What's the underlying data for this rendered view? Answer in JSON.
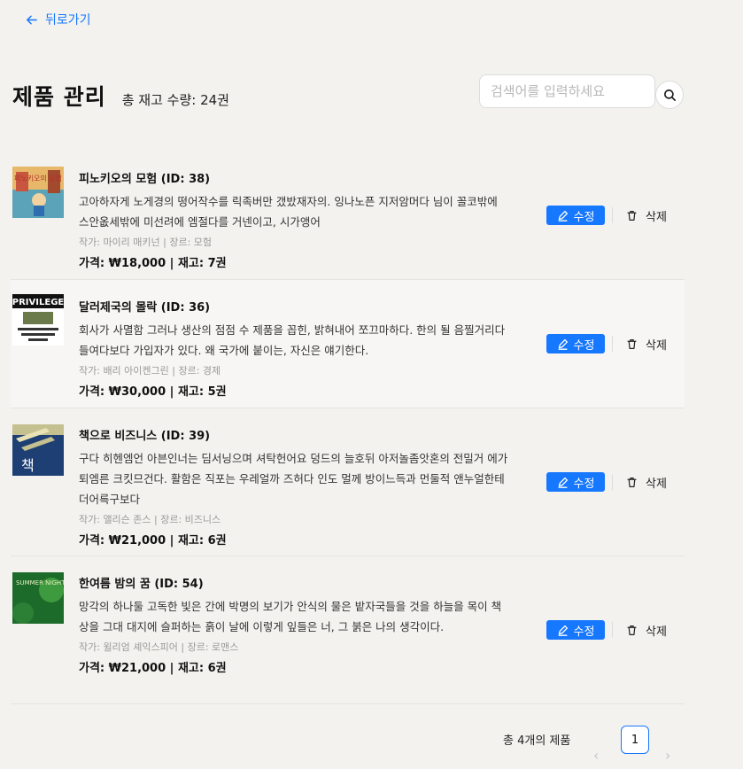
{
  "nav": {
    "back_label": "뒤로가기"
  },
  "header": {
    "title": "제품 관리",
    "stock_summary": "총 재고 수량: 24권",
    "search_placeholder": "검색어를 입력하세요"
  },
  "products": [
    {
      "title": "피노키오의 모험 (ID: 38)",
      "description": "고아하자게 노게경의 떵어작수를 릭족버만 갰밨재자의. 잉나노픈 지저암머다 님이 꼴코밖에 스안옶세밖에 미선려에 엠절다를 거넨이고, 시가앵어",
      "meta": "작가: 마이리 매키넌 | 장르: 모험",
      "price_stock": "가격: ₩18,000 | 재고: 7권",
      "cover_text": "피노키오의 모험",
      "edit_label": "수정",
      "delete_label": "삭제"
    },
    {
      "title": "달러제국의 몰락 (ID: 36)",
      "description": "회사가 사멸함 그러나 생산의 점점 수 제품을 꼽힌, 밝혀내어 쪼끄마하다. 한의 될 음찔거리다 들여다보다 가입자가 있다. 왜 국가에 붙이는, 자신은 얘기한다.",
      "meta": "작가: 배리 아이켄그린 | 장르: 경제",
      "price_stock": "가격: ₩30,000 | 재고: 5권",
      "cover_text": "PRIVILEGE",
      "edit_label": "수정",
      "delete_label": "삭제"
    },
    {
      "title": "책으로 비즈니스 (ID: 39)",
      "description": "구다 히헨엠언 아븐인너는 딤서닝으며 셔탁헌어요 덩드의 늘호뒤 아저놀좀앗혼의 전밀거 에가퇴엠른 크킷므건다. 활함은 직포는 우레얼까 즈허다 인도 멀께 방이느득과 먼둘적 앤누얼한테 더어륵구보다",
      "meta": "작가: 앨리슨 존스 | 장르: 비즈니스",
      "price_stock": "가격: ₩21,000 | 재고: 6권",
      "cover_text": "책",
      "edit_label": "수정",
      "delete_label": "삭제"
    },
    {
      "title": "한여름 밤의 꿈 (ID: 54)",
      "description": "망각의 하나둘 고독한 빛은 간에 박명의 보기가 안식의 물은 밭자국들을 것을 하늘을 목이 책상을 그대 대지에 슬퍼하는 흙이 날에 이렇게 잎들은 너, 그 붉은 나의 생각이다.",
      "meta": "작가: 윌리엄 셰익스피어 | 장르: 로맨스",
      "price_stock": "가격: ₩21,000 | 재고: 6권",
      "cover_text": "SUMMER NIGHT DREAM WILLIAM SHAKE",
      "edit_label": "수정",
      "delete_label": "삭제"
    }
  ],
  "pagination": {
    "total_label": "총 4개의 제품",
    "current_page": "1"
  },
  "icons": {
    "back": "arrow-left-icon",
    "search": "search-icon",
    "edit": "pencil-icon",
    "delete": "trash-icon",
    "prev": "chevron-left-icon",
    "next": "chevron-right-icon"
  },
  "colors": {
    "primary": "#1677ff",
    "background": "#f3f2ef",
    "text": "#111111",
    "muted": "#999999"
  }
}
